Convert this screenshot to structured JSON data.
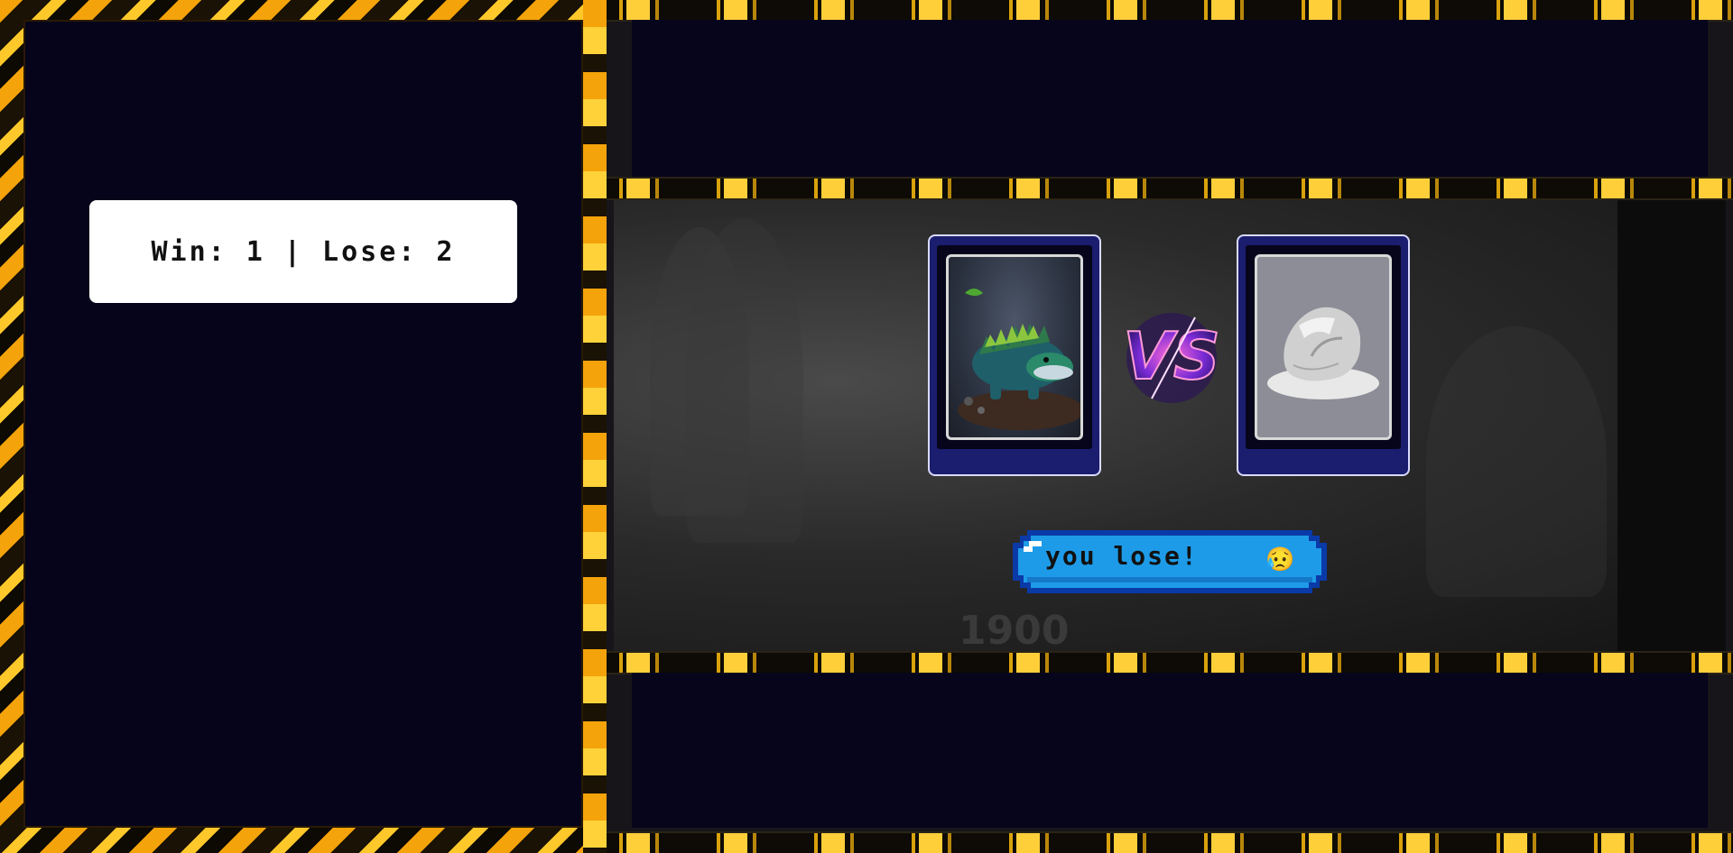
{
  "scoreboard": {
    "text": "Win: 1 | Lose: 2",
    "wins": 1,
    "losses": 2
  },
  "battle": {
    "player_card": {
      "icon": "dino-creature-icon"
    },
    "opponent_card": {
      "icon": "rock-icon"
    },
    "versus_label": "VS",
    "result_text": "you lose!",
    "result_emoji": "😥"
  },
  "arena_watermark": "1900",
  "colors": {
    "frame_gold": "#f4a30a",
    "panel_navy": "#05041a",
    "card_blue": "#1b1d6e",
    "banner_blue": "#1e9be8"
  }
}
